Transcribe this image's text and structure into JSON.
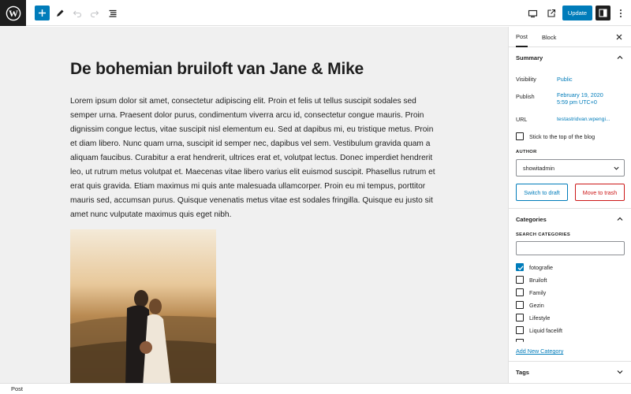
{
  "topbar": {
    "update_label": "Update",
    "icons": [
      "wordpress-logo",
      "add-block-icon",
      "tools-pencil-icon",
      "undo-icon",
      "redo-icon",
      "list-view-icon",
      "preview-desktop-icon",
      "view-post-icon",
      "settings-sidebar-icon",
      "options-more-icon"
    ]
  },
  "editor": {
    "title": "De bohemian bruiloft van Jane & Mike",
    "body": "Lorem ipsum dolor sit amet, consectetur adipiscing elit. Proin et felis ut tellus suscipit sodales sed semper urna. Praesent dolor purus, condimentum viverra arcu id, consectetur congue mauris. Proin dignissim congue lectus, vitae suscipit nisl elementum eu. Sed at dapibus mi, eu tristique metus. Proin et diam libero. Nunc quam urna, suscipit id semper nec, dapibus vel sem. Vestibulum gravida quam a aliquam faucibus. Curabitur a erat hendrerit, ultrices erat et, volutpat lectus. Donec imperdiet hendrerit leo, ut rutrum metus volutpat et. Maecenas vitae libero varius elit euismod suscipit. Phasellus rutrum et erat quis gravida. Etiam maximus mi quis ante malesuada ullamcorper. Proin eu mi tempus, porttitor mauris sed, accumsan purus. Quisque venenatis metus vitae est sodales fringilla. Quisque eu justo sit amet nunc vulputate maximus quis eget nibh."
  },
  "statusbar": {
    "label": "Post"
  },
  "sidebar": {
    "tab_post": "Post",
    "tab_block": "Block",
    "summary": {
      "heading": "Summary",
      "visibility_label": "Visibility",
      "visibility_value": "Public",
      "publish_label": "Publish",
      "publish_date": "February 19, 2020",
      "publish_time": "5:59 pm UTC+0",
      "url_label": "URL",
      "url_value": "testastridvan.wpengi...",
      "sticky_label": "Stick to the top of the blog",
      "author_label": "AUTHOR",
      "author_value": "showitadmin",
      "switch_draft": "Switch to draft",
      "move_trash": "Move to trash"
    },
    "categories": {
      "heading": "Categories",
      "search_label": "SEARCH CATEGORIES",
      "items": [
        {
          "label": "fotografie",
          "checked": true
        },
        {
          "label": "Bruiloft",
          "checked": false
        },
        {
          "label": "Family",
          "checked": false
        },
        {
          "label": "Gezin",
          "checked": false
        },
        {
          "label": "Lifestyle",
          "checked": false
        },
        {
          "label": "Liquid facelift",
          "checked": false
        }
      ],
      "add_new": "Add New Category"
    },
    "tags": {
      "heading": "Tags"
    }
  },
  "colors": {
    "accent": "#007cba",
    "danger": "#cc1818",
    "canvas": "#f0f0f0",
    "dark": "#1e1e1e"
  }
}
